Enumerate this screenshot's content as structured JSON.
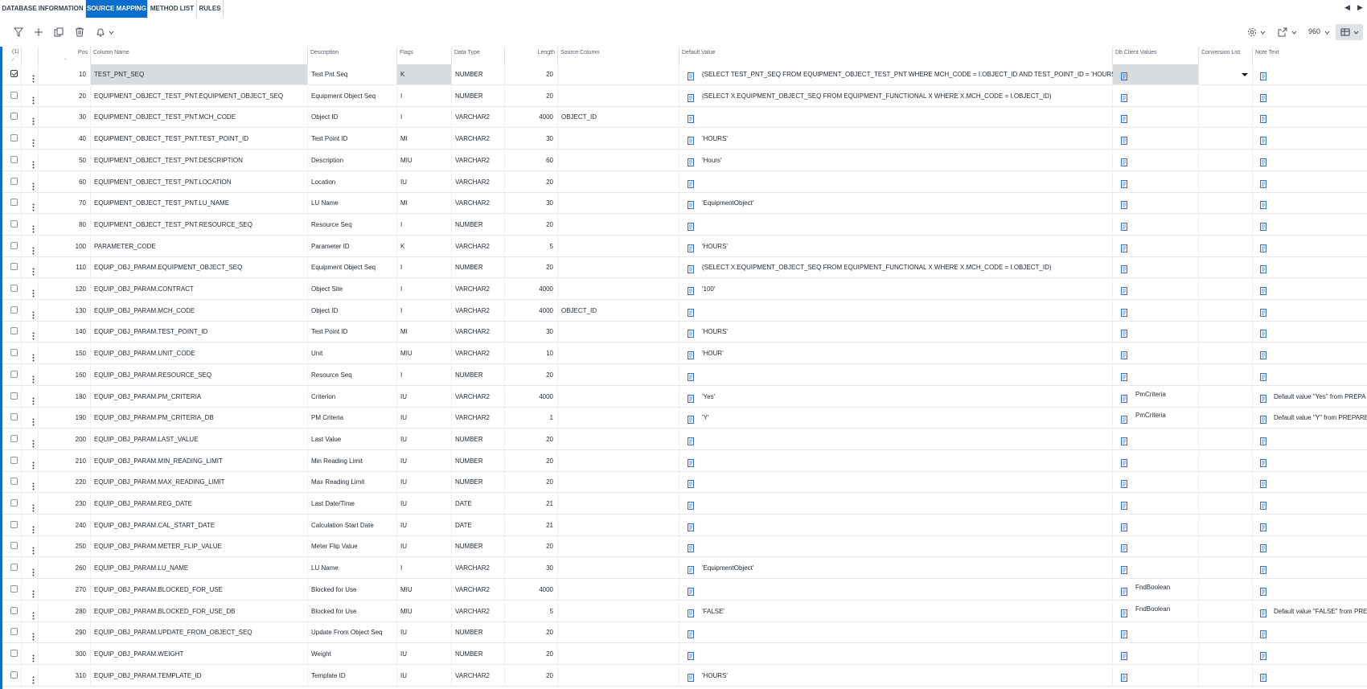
{
  "tabs": [
    {
      "label": "DATABASE INFORMATION",
      "active": false
    },
    {
      "label": "SOURCE MAPPING",
      "active": true
    },
    {
      "label": "METHOD LIST",
      "active": false
    },
    {
      "label": "RULES",
      "active": false
    }
  ],
  "toolbar": {
    "icons": [
      "filter-icon",
      "add-icon",
      "duplicate-icon",
      "delete-icon",
      "bell-icon"
    ],
    "right_icons": [
      "gear-icon",
      "export-icon",
      "table-view-icon"
    ],
    "page_size": "960"
  },
  "grid": {
    "selected_count": "(1)",
    "headers": {
      "pos": "Pos",
      "column_name": "Column Name",
      "description": "Description",
      "flags": "Flags",
      "data_type": "Data Type",
      "length": "Length",
      "source_column": "Source Column",
      "default_value": "Default Value",
      "db_client_values": "Db Client Values",
      "conversion_list": "Conversion List",
      "note_text": "Note Text"
    },
    "rows": [
      {
        "pos": "10",
        "column_name": "TEST_PNT_SEQ",
        "description": "Test Pnt Seq",
        "flags": "K",
        "data_type": "NUMBER",
        "length": "20",
        "source_column": "",
        "default_value": "(SELECT TEST_PNT_SEQ FROM EQUIPMENT_OBJECT_TEST_PNT WHERE MCH_CODE = I.OBJECT_ID AND TEST_POINT_ID = 'HOURS')",
        "db_client_values": "",
        "note_text": "",
        "selected": true
      },
      {
        "pos": "20",
        "column_name": "EQUIPMENT_OBJECT_TEST_PNT.EQUIPMENT_OBJECT_SEQ",
        "description": "Equipment Object Seq",
        "flags": "I",
        "data_type": "NUMBER",
        "length": "20",
        "source_column": "",
        "default_value": "(SELECT X.EQUIPMENT_OBJECT_SEQ FROM EQUIPMENT_FUNCTIONAL X WHERE X.MCH_CODE = I.OBJECT_ID)",
        "db_client_values": "",
        "note_text": ""
      },
      {
        "pos": "30",
        "column_name": "EQUIPMENT_OBJECT_TEST_PNT.MCH_CODE",
        "description": "Object ID",
        "flags": "I",
        "data_type": "VARCHAR2",
        "length": "4000",
        "source_column": "OBJECT_ID",
        "default_value": "",
        "db_client_values": "",
        "note_text": ""
      },
      {
        "pos": "40",
        "column_name": "EQUIPMENT_OBJECT_TEST_PNT.TEST_POINT_ID",
        "description": "Test Point ID",
        "flags": "MI",
        "data_type": "VARCHAR2",
        "length": "30",
        "source_column": "",
        "default_value": "'HOURS'",
        "db_client_values": "",
        "note_text": ""
      },
      {
        "pos": "50",
        "column_name": "EQUIPMENT_OBJECT_TEST_PNT.DESCRIPTION",
        "description": "Description",
        "flags": "MIU",
        "data_type": "VARCHAR2",
        "length": "60",
        "source_column": "",
        "default_value": "'Hours'",
        "db_client_values": "",
        "note_text": ""
      },
      {
        "pos": "60",
        "column_name": "EQUIPMENT_OBJECT_TEST_PNT.LOCATION",
        "description": "Location",
        "flags": "IU",
        "data_type": "VARCHAR2",
        "length": "20",
        "source_column": "",
        "default_value": "",
        "db_client_values": "",
        "note_text": ""
      },
      {
        "pos": "70",
        "column_name": "EQUIPMENT_OBJECT_TEST_PNT.LU_NAME",
        "description": "LU Name",
        "flags": "MI",
        "data_type": "VARCHAR2",
        "length": "30",
        "source_column": "",
        "default_value": "'EquipmentObject'",
        "db_client_values": "",
        "note_text": ""
      },
      {
        "pos": "80",
        "column_name": "EQUIPMENT_OBJECT_TEST_PNT.RESOURCE_SEQ",
        "description": "Resource Seq",
        "flags": "I",
        "data_type": "NUMBER",
        "length": "20",
        "source_column": "",
        "default_value": "",
        "db_client_values": "",
        "note_text": ""
      },
      {
        "pos": "100",
        "column_name": "PARAMETER_CODE",
        "description": "Parameter ID",
        "flags": "K",
        "data_type": "VARCHAR2",
        "length": "5",
        "source_column": "",
        "default_value": "'HOURS'",
        "db_client_values": "",
        "note_text": ""
      },
      {
        "pos": "110",
        "column_name": "EQUIP_OBJ_PARAM.EQUIPMENT_OBJECT_SEQ",
        "description": "Equipment Object Seq",
        "flags": "I",
        "data_type": "NUMBER",
        "length": "20",
        "source_column": "",
        "default_value": "(SELECT X.EQUIPMENT_OBJECT_SEQ FROM EQUIPMENT_FUNCTIONAL X WHERE X.MCH_CODE = I.OBJECT_ID)",
        "db_client_values": "",
        "note_text": ""
      },
      {
        "pos": "120",
        "column_name": "EQUIP_OBJ_PARAM.CONTRACT",
        "description": "Object Site",
        "flags": "I",
        "data_type": "VARCHAR2",
        "length": "4000",
        "source_column": "",
        "default_value": "'100'",
        "db_client_values": "",
        "note_text": ""
      },
      {
        "pos": "130",
        "column_name": "EQUIP_OBJ_PARAM.MCH_CODE",
        "description": "Object ID",
        "flags": "I",
        "data_type": "VARCHAR2",
        "length": "4000",
        "source_column": "OBJECT_ID",
        "default_value": "",
        "db_client_values": "",
        "note_text": ""
      },
      {
        "pos": "140",
        "column_name": "EQUIP_OBJ_PARAM.TEST_POINT_ID",
        "description": "Test Point ID",
        "flags": "MI",
        "data_type": "VARCHAR2",
        "length": "30",
        "source_column": "",
        "default_value": "'HOURS'",
        "db_client_values": "",
        "note_text": ""
      },
      {
        "pos": "150",
        "column_name": "EQUIP_OBJ_PARAM.UNIT_CODE",
        "description": "Unit",
        "flags": "MIU",
        "data_type": "VARCHAR2",
        "length": "10",
        "source_column": "",
        "default_value": "'HOUR'",
        "db_client_values": "",
        "note_text": ""
      },
      {
        "pos": "160",
        "column_name": "EQUIP_OBJ_PARAM.RESOURCE_SEQ",
        "description": "Resource Seq",
        "flags": "I",
        "data_type": "NUMBER",
        "length": "20",
        "source_column": "",
        "default_value": "",
        "db_client_values": "",
        "note_text": ""
      },
      {
        "pos": "180",
        "column_name": "EQUIP_OBJ_PARAM.PM_CRITERIA",
        "description": "Criterion",
        "flags": "IU",
        "data_type": "VARCHAR2",
        "length": "4000",
        "source_column": "",
        "default_value": "'Yes'",
        "db_client_values": "PmCriteria",
        "note_text": "Default value \"Yes\" from PREPA"
      },
      {
        "pos": "190",
        "column_name": "EQUIP_OBJ_PARAM.PM_CRITERIA_DB",
        "description": "PM Criteria",
        "flags": "IU",
        "data_type": "VARCHAR2",
        "length": "1",
        "source_column": "",
        "default_value": "'Y'",
        "db_client_values": "PmCriteria",
        "note_text": "Default value \"Y\" from PREPARE"
      },
      {
        "pos": "200",
        "column_name": "EQUIP_OBJ_PARAM.LAST_VALUE",
        "description": "Last Value",
        "flags": "IU",
        "data_type": "NUMBER",
        "length": "20",
        "source_column": "",
        "default_value": "",
        "db_client_values": "",
        "note_text": ""
      },
      {
        "pos": "210",
        "column_name": "EQUIP_OBJ_PARAM.MIN_READING_LIMIT",
        "description": "Min Reading Limit",
        "flags": "IU",
        "data_type": "NUMBER",
        "length": "20",
        "source_column": "",
        "default_value": "",
        "db_client_values": "",
        "note_text": ""
      },
      {
        "pos": "220",
        "column_name": "EQUIP_OBJ_PARAM.MAX_READING_LIMIT",
        "description": "Max Reading Limit",
        "flags": "IU",
        "data_type": "NUMBER",
        "length": "20",
        "source_column": "",
        "default_value": "",
        "db_client_values": "",
        "note_text": ""
      },
      {
        "pos": "230",
        "column_name": "EQUIP_OBJ_PARAM.REG_DATE",
        "description": "Last Date/Time",
        "flags": "IU",
        "data_type": "DATE",
        "length": "21",
        "source_column": "",
        "default_value": "",
        "db_client_values": "",
        "note_text": ""
      },
      {
        "pos": "240",
        "column_name": "EQUIP_OBJ_PARAM.CAL_START_DATE",
        "description": "Calculation Start Date",
        "flags": "IU",
        "data_type": "DATE",
        "length": "21",
        "source_column": "",
        "default_value": "",
        "db_client_values": "",
        "note_text": ""
      },
      {
        "pos": "250",
        "column_name": "EQUIP_OBJ_PARAM.METER_FLIP_VALUE",
        "description": "Meter Flip Value",
        "flags": "IU",
        "data_type": "NUMBER",
        "length": "20",
        "source_column": "",
        "default_value": "",
        "db_client_values": "",
        "note_text": ""
      },
      {
        "pos": "260",
        "column_name": "EQUIP_OBJ_PARAM.LU_NAME",
        "description": "LU Name",
        "flags": "I",
        "data_type": "VARCHAR2",
        "length": "30",
        "source_column": "",
        "default_value": "'EquipmentObject'",
        "db_client_values": "",
        "note_text": ""
      },
      {
        "pos": "270",
        "column_name": "EQUIP_OBJ_PARAM.BLOCKED_FOR_USE",
        "description": "Blocked for Use",
        "flags": "MIU",
        "data_type": "VARCHAR2",
        "length": "4000",
        "source_column": "",
        "default_value": "",
        "db_client_values": "FndBoolean",
        "note_text": ""
      },
      {
        "pos": "280",
        "column_name": "EQUIP_OBJ_PARAM.BLOCKED_FOR_USE_DB",
        "description": "Blocked for Use",
        "flags": "MIU",
        "data_type": "VARCHAR2",
        "length": "5",
        "source_column": "",
        "default_value": "'FALSE'",
        "db_client_values": "FndBoolean",
        "note_text": "Default value \"FALSE\" from PRE"
      },
      {
        "pos": "290",
        "column_name": "EQUIP_OBJ_PARAM.UPDATE_FROM_OBJECT_SEQ",
        "description": "Update From Object Seq",
        "flags": "IU",
        "data_type": "NUMBER",
        "length": "20",
        "source_column": "",
        "default_value": "",
        "db_client_values": "",
        "note_text": ""
      },
      {
        "pos": "300",
        "column_name": "EQUIP_OBJ_PARAM.WEIGHT",
        "description": "Weight",
        "flags": "IU",
        "data_type": "NUMBER",
        "length": "20",
        "source_column": "",
        "default_value": "",
        "db_client_values": "",
        "note_text": ""
      },
      {
        "pos": "310",
        "column_name": "EQUIP_OBJ_PARAM.TEMPLATE_ID",
        "description": "Template ID",
        "flags": "IU",
        "data_type": "VARCHAR2",
        "length": "20",
        "source_column": "",
        "default_value": "'HOURS'",
        "db_client_values": "",
        "note_text": ""
      }
    ]
  },
  "colors": {
    "accent": "#0a6ed1",
    "key_cell": "#d9dcdf",
    "doc_icon": "#2d6fd0"
  }
}
